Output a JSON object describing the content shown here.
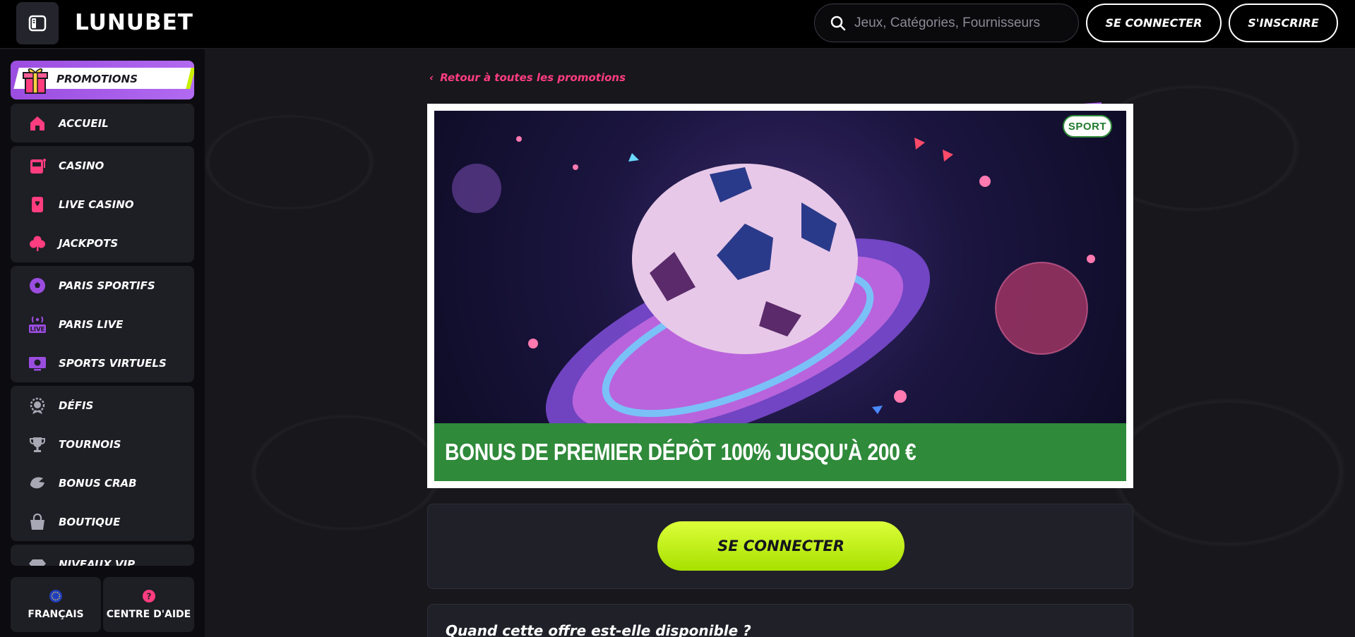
{
  "header": {
    "logo_text": "LUNUBET",
    "search_placeholder": "Jeux, Catégories, Fournisseurs",
    "connect_label": "SE CONNECTER",
    "register_label": "S'INSCRIRE"
  },
  "sidebar": {
    "promotions_label": "PROMOTIONS",
    "items": [
      {
        "label": "ACCUEIL",
        "icon": "home-icon"
      },
      {
        "label": "CASINO",
        "icon": "slot-machine-icon"
      },
      {
        "label": "LIVE CASINO",
        "icon": "playing-card-icon"
      },
      {
        "label": "JACKPOTS",
        "icon": "clover-icon"
      },
      {
        "label": "PARIS SPORTIFS",
        "icon": "soccer-ball-icon"
      },
      {
        "label": "PARIS LIVE",
        "icon": "live-broadcast-icon"
      },
      {
        "label": "SPORTS VIRTUELS",
        "icon": "virtual-screen-icon"
      },
      {
        "label": "DÉFIS",
        "icon": "medal-icon"
      },
      {
        "label": "TOURNOIS",
        "icon": "trophy-icon"
      },
      {
        "label": "BONUS CRAB",
        "icon": "crab-claw-icon"
      },
      {
        "label": "BOUTIQUE",
        "icon": "shopping-bag-icon"
      },
      {
        "label": "NIVEAUX VIP",
        "icon": "diamond-icon"
      }
    ],
    "language_label": "FRANÇAIS",
    "help_label": "CENTRE D'AIDE"
  },
  "main": {
    "back_link": "Retour à toutes les promotions",
    "banner_title": "BONUS DE PREMIER DÉPÔT 100% JUSQU'À 200 €",
    "badge": "SPORT",
    "cta_label": "SE CONNECTER",
    "faq_question": "Quand cette offre est-elle disponible ?"
  },
  "colors": {
    "accent_pink": "#ff3d7f",
    "accent_purple": "#9b4de0",
    "accent_lime": "#c8f000",
    "banner_green": "#2f8a3a"
  }
}
